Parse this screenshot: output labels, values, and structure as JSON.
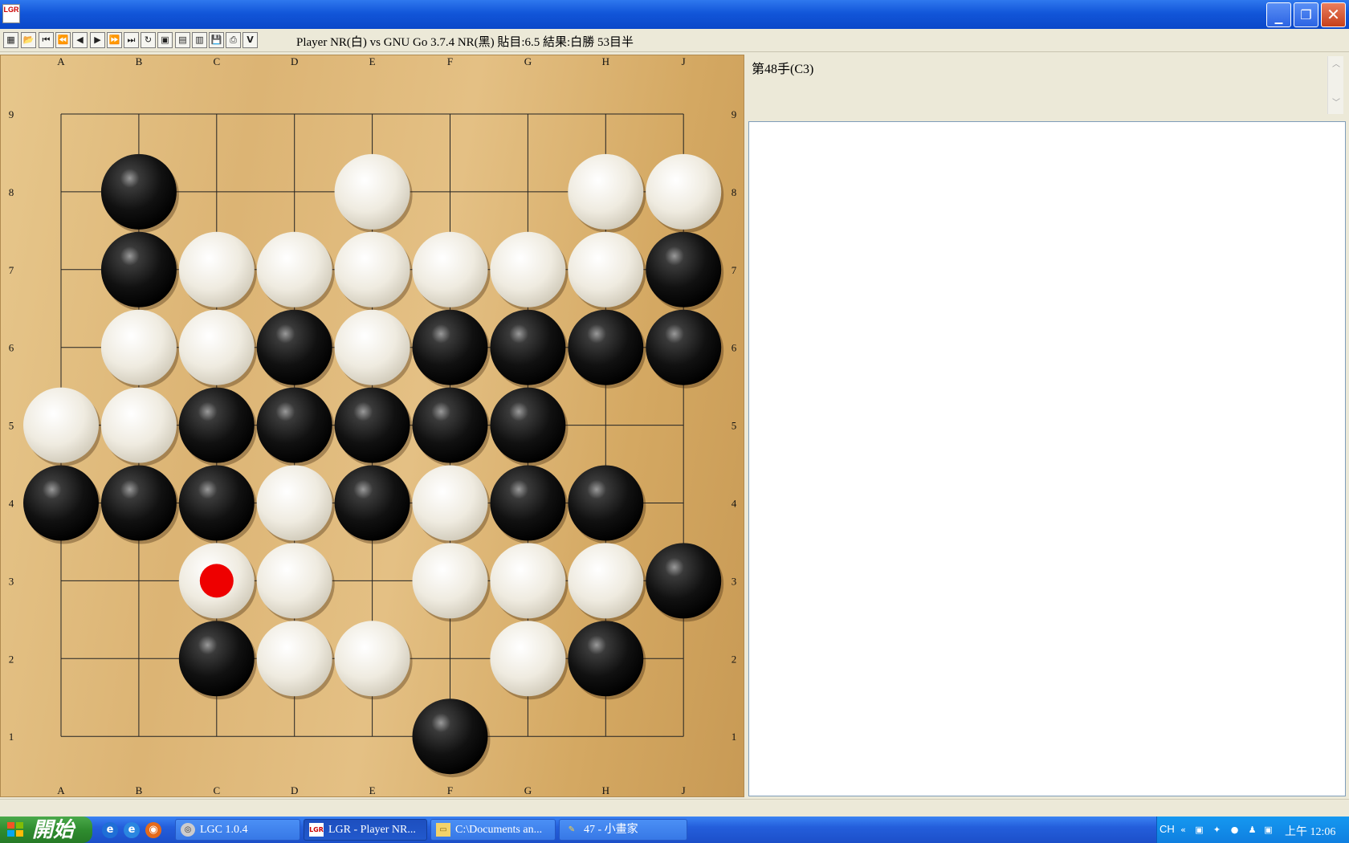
{
  "window": {
    "icon_text": "LGR"
  },
  "toolbar": {
    "buttons": [
      "new-game",
      "open",
      "first-move",
      "back-10",
      "back-1",
      "forward-1",
      "forward-10",
      "last-move",
      "undo",
      "save-board",
      "edit",
      "notes",
      "save",
      "print",
      "version"
    ],
    "version_label": "V",
    "game_info": "Player NR(白) vs GNU Go 3.7.4 NR(黑) 貼目:6.5 結果:白勝 53目半"
  },
  "board": {
    "size": 9,
    "columns": [
      "A",
      "B",
      "C",
      "D",
      "E",
      "F",
      "G",
      "H",
      "J"
    ],
    "rows": [
      "9",
      "8",
      "7",
      "6",
      "5",
      "4",
      "3",
      "2",
      "1"
    ],
    "black_stones": [
      "B8",
      "B7",
      "J7",
      "D6",
      "F6",
      "G6",
      "H6",
      "J6",
      "C5",
      "D5",
      "E5",
      "F5",
      "G5",
      "A4",
      "B4",
      "C4",
      "E4",
      "G4",
      "H4",
      "J3",
      "C2",
      "H2",
      "F1"
    ],
    "white_stones": [
      "E8",
      "H8",
      "J8",
      "C7",
      "D7",
      "E7",
      "F7",
      "G7",
      "H7",
      "B6",
      "C6",
      "E6",
      "A5",
      "B5",
      "D4",
      "F4",
      "C3",
      "D3",
      "F3",
      "G3",
      "H3",
      "D2",
      "E2",
      "G2"
    ],
    "last_move": "C3",
    "last_move_marker_color": "#ee0000"
  },
  "side_panel": {
    "move_label": "第48手(C3)",
    "comment": ""
  },
  "taskbar": {
    "start_label": "開始",
    "quick_launch": [
      "ie-icon",
      "ie-alt-icon",
      "firefox-icon"
    ],
    "tasks": [
      {
        "label": "LGC 1.0.4",
        "icon": "lgc-icon",
        "active": false
      },
      {
        "label": "LGR - Player NR...",
        "icon": "lgr-icon",
        "active": true
      },
      {
        "label": "C:\\Documents an...",
        "icon": "folder-icon",
        "active": false
      },
      {
        "label": "47 - 小畫家",
        "icon": "paint-icon",
        "active": false
      }
    ],
    "tray": {
      "ime": "CH",
      "clock": "上午 12:06"
    }
  },
  "colors": {
    "title_blue": "#0a47c9",
    "board_wood": "#dcb474",
    "taskbar_blue": "#245edb",
    "start_green": "#2f8c2f"
  }
}
